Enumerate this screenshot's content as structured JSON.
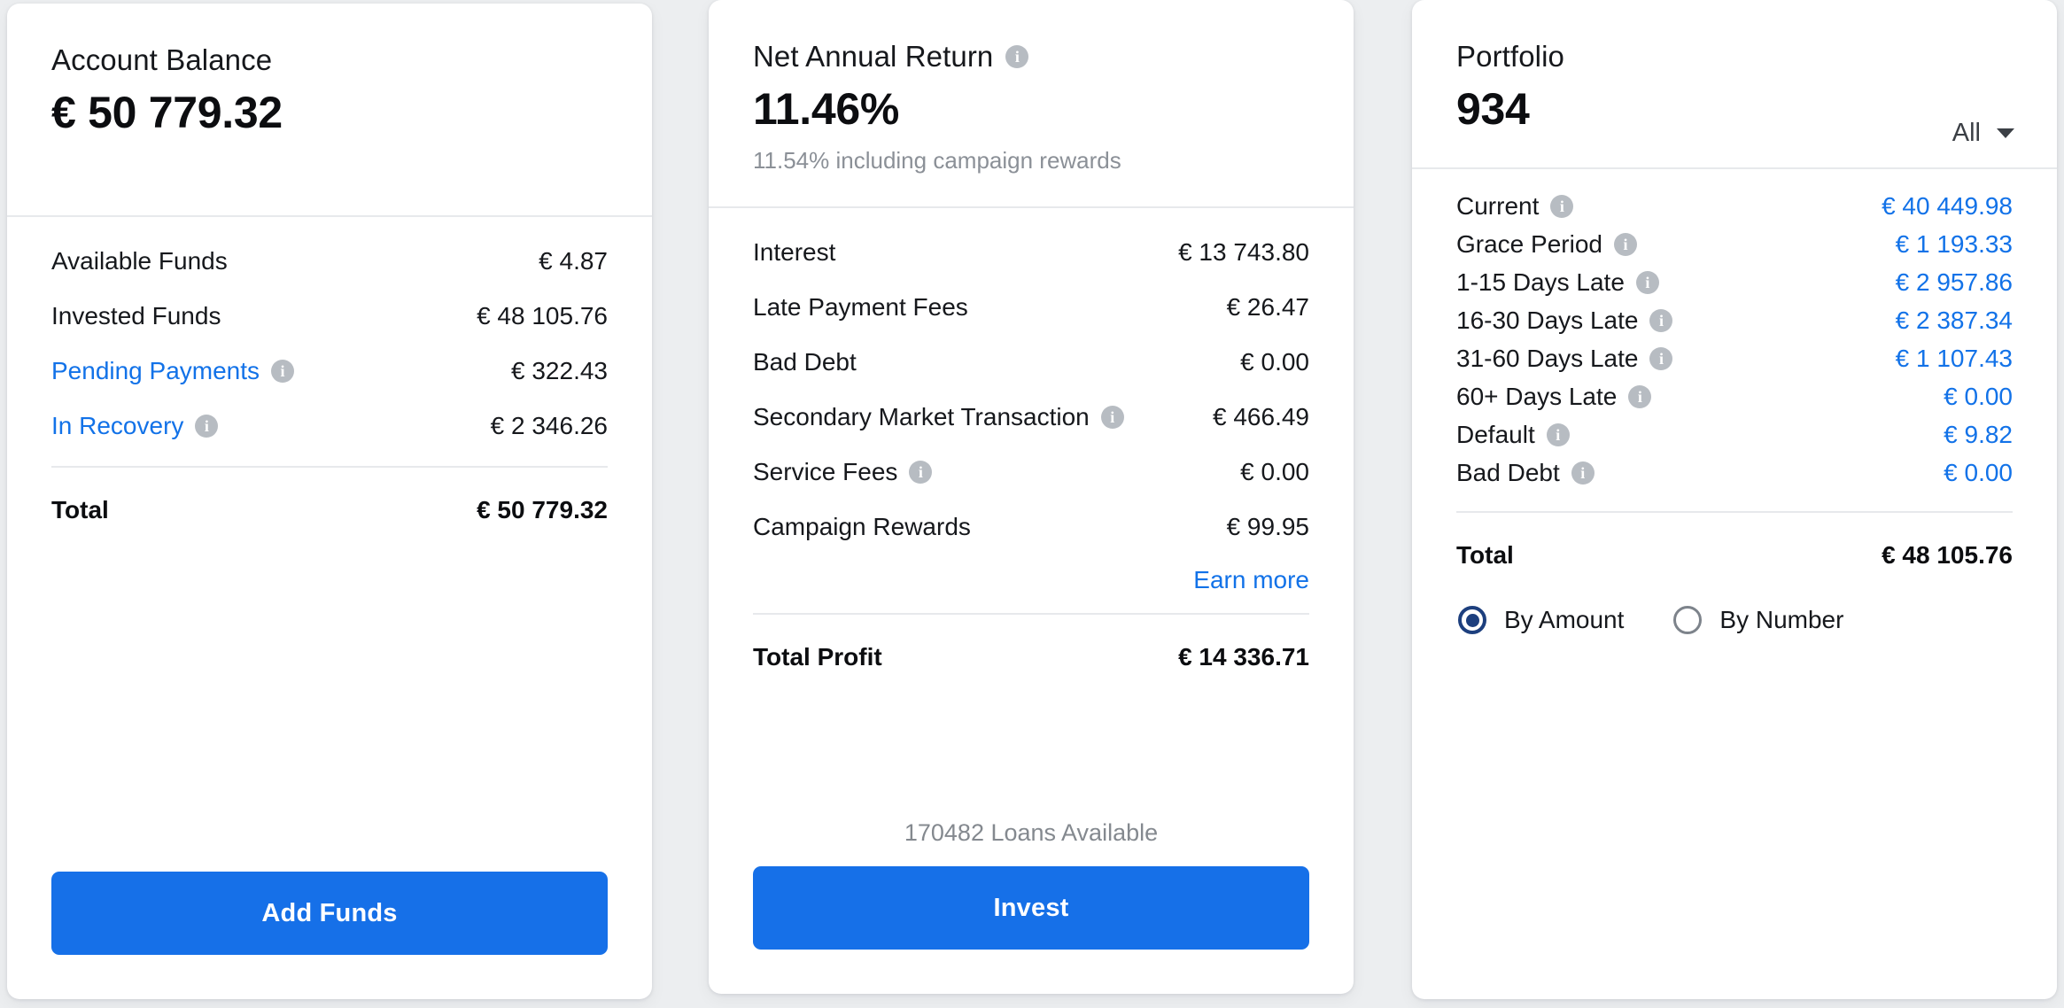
{
  "theme": {
    "page_bg": "#eceef0",
    "card_bg": "#ffffff",
    "accent_blue": "#1272e8",
    "cta_blue": "#1670e8",
    "radio_selected": "#1d3f7e",
    "muted_text": "#84898f",
    "divider": "#e7e9ec"
  },
  "account_balance": {
    "title": "Account Balance",
    "amount": "€ 50 779.32",
    "rows": [
      {
        "label": "Available Funds",
        "value": "€ 4.87",
        "label_link": false,
        "info": false,
        "value_blue": false
      },
      {
        "label": "Invested Funds",
        "value": "€ 48 105.76",
        "label_link": false,
        "info": false,
        "value_blue": false
      },
      {
        "label": "Pending Payments",
        "value": "€ 322.43",
        "label_link": true,
        "info": true,
        "value_blue": false
      },
      {
        "label": "In Recovery",
        "value": "€ 2 346.26",
        "label_link": true,
        "info": true,
        "value_blue": false
      }
    ],
    "total_label": "Total",
    "total_value": "€ 50 779.32",
    "cta_label": "Add Funds"
  },
  "net_annual_return": {
    "title": "Net Annual Return",
    "title_info": true,
    "amount": "11.46%",
    "subnote": "11.54% including campaign rewards",
    "rows": [
      {
        "label": "Interest",
        "value": "€ 13 743.80",
        "label_link": false,
        "info": false,
        "value_blue": false
      },
      {
        "label": "Late Payment Fees",
        "value": "€ 26.47",
        "label_link": false,
        "info": false,
        "value_blue": false
      },
      {
        "label": "Bad Debt",
        "value": "€ 0.00",
        "label_link": false,
        "info": false,
        "value_blue": false
      },
      {
        "label": "Secondary Market Transaction",
        "value": "€ 466.49",
        "label_link": false,
        "info": true,
        "value_blue": false
      },
      {
        "label": "Service Fees",
        "value": "€ 0.00",
        "label_link": false,
        "info": true,
        "value_blue": false
      },
      {
        "label": "Campaign Rewards",
        "value": "€ 99.95",
        "label_link": false,
        "info": false,
        "value_blue": false
      }
    ],
    "earn_more_label": "Earn more",
    "total_label": "Total Profit",
    "total_value": "€ 14 336.71",
    "loans_note": "170482 Loans Available",
    "cta_label": "Invest"
  },
  "portfolio": {
    "title": "Portfolio",
    "amount": "934",
    "filter_label": "All",
    "rows": [
      {
        "label": "Current",
        "value": "€ 40 449.98",
        "label_link": false,
        "info": true,
        "value_blue": true
      },
      {
        "label": "Grace Period",
        "value": "€ 1 193.33",
        "label_link": false,
        "info": true,
        "value_blue": true
      },
      {
        "label": "1-15 Days Late",
        "value": "€ 2 957.86",
        "label_link": false,
        "info": true,
        "value_blue": true
      },
      {
        "label": "16-30 Days Late",
        "value": "€ 2 387.34",
        "label_link": false,
        "info": true,
        "value_blue": true
      },
      {
        "label": "31-60 Days Late",
        "value": "€ 1 107.43",
        "label_link": false,
        "info": true,
        "value_blue": true
      },
      {
        "label": "60+ Days Late",
        "value": "€ 0.00",
        "label_link": false,
        "info": true,
        "value_blue": true
      },
      {
        "label": "Default",
        "value": "€ 9.82",
        "label_link": false,
        "info": true,
        "value_blue": true
      },
      {
        "label": "Bad Debt",
        "value": "€ 0.00",
        "label_link": false,
        "info": true,
        "value_blue": true
      }
    ],
    "total_label": "Total",
    "total_value": "€ 48 105.76",
    "view_options": [
      {
        "label": "By Amount",
        "selected": true
      },
      {
        "label": "By Number",
        "selected": false
      }
    ]
  }
}
